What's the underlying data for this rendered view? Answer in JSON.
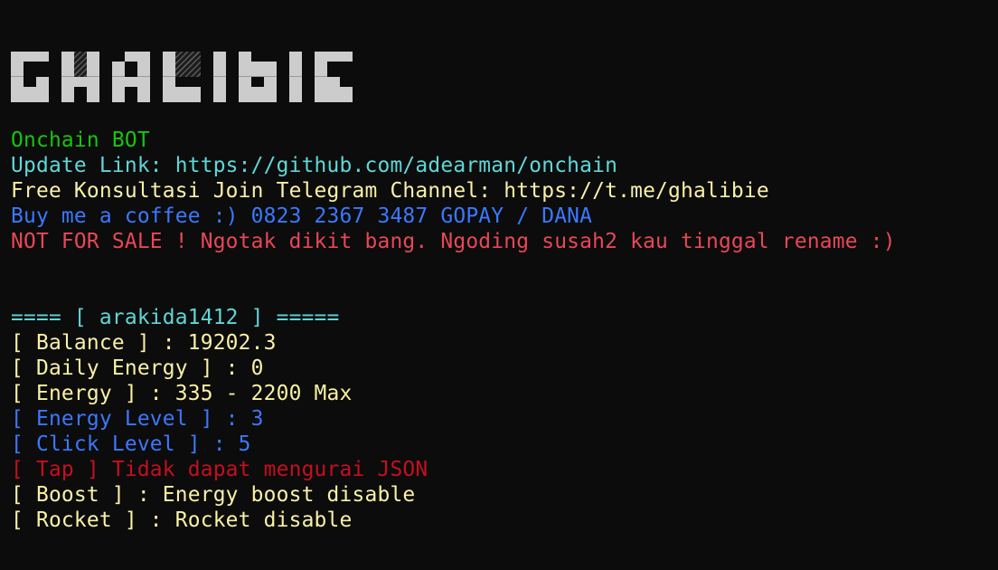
{
  "terminal": {
    "logo_text": "GHALIBIE",
    "colors": {
      "background": "#0c0c0c",
      "logo": "#cccccc",
      "green": "#16c60c",
      "cyan": "#61d6d6",
      "yellow": "#f9f1a5",
      "blue": "#3b78ff",
      "bright_red": "#e74856",
      "dark_red": "#c50f1f"
    },
    "header": {
      "title": "Onchain BOT",
      "update_link": "Update Link: https://github.com/adearman/onchain",
      "telegram": "Free Konsultasi Join Telegram Channel: https://t.me/ghalibie",
      "donate": "Buy me a coffee :) 0823 2367 3487 GOPAY / DANA",
      "warning": "NOT FOR SALE ! Ngotak dikit bang. Ngoding susah2 kau tinggal rename :)"
    },
    "account": {
      "separator": "==== [ arakida1412 ] =====",
      "username": "arakida1412",
      "balance": "[ Balance ] : 19202.3",
      "daily_energy": "[ Daily Energy ] : 0",
      "energy": "[ Energy ] : 335 - 2200 Max",
      "energy_level": "[ Energy Level ] : 3",
      "click_level": "[ Click Level ] : 5",
      "tap": "[ Tap ] Tidak dapat mengurai JSON",
      "boost": "[ Boost ] : Energy boost disable",
      "rocket": "[ Rocket ] : Rocket disable"
    }
  }
}
